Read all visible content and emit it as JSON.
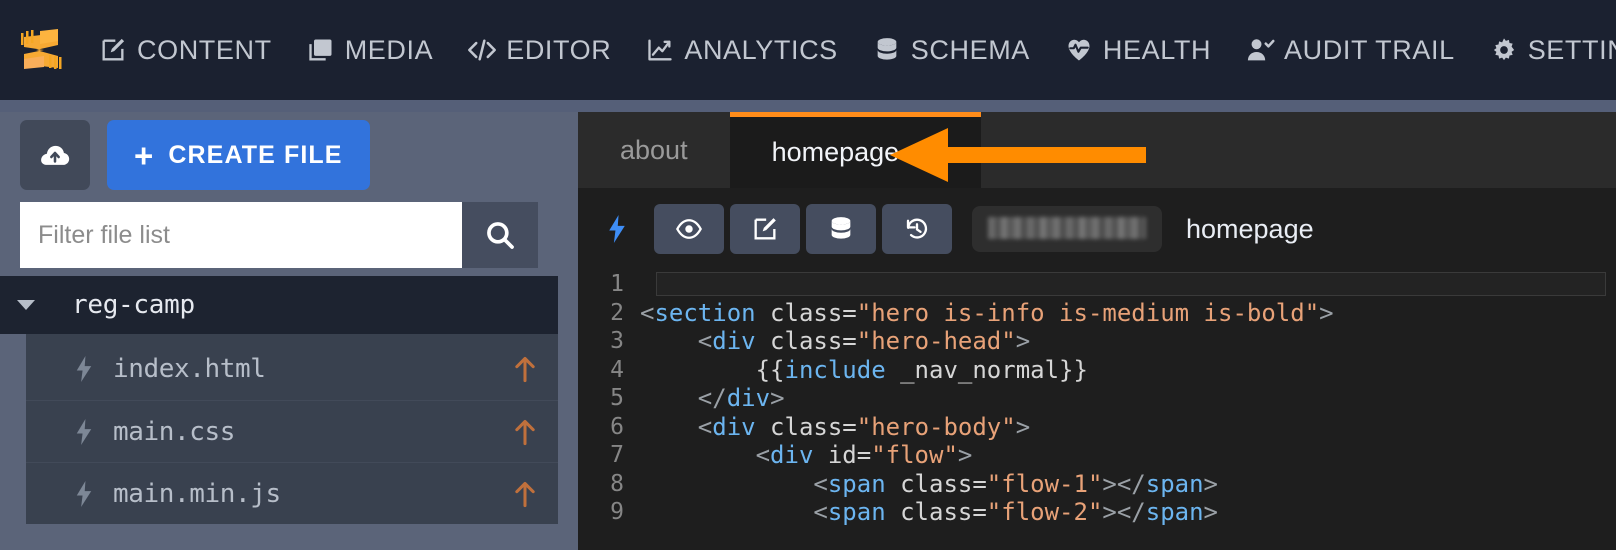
{
  "navbar": {
    "logo_name": "zesty-logo",
    "items": [
      {
        "label": "CONTENT",
        "icon": "content-edit-icon"
      },
      {
        "label": "MEDIA",
        "icon": "media-image-icon"
      },
      {
        "label": "EDITOR",
        "icon": "code-brackets-icon"
      },
      {
        "label": "ANALYTICS",
        "icon": "chart-line-icon"
      },
      {
        "label": "SCHEMA",
        "icon": "database-icon"
      },
      {
        "label": "HEALTH",
        "icon": "heart-pulse-icon"
      },
      {
        "label": "AUDIT TRAIL",
        "icon": "user-check-icon"
      },
      {
        "label": "SETTINGS",
        "icon": "gear-icon"
      }
    ]
  },
  "sidebar": {
    "upload_button": {
      "name": "upload-button",
      "icon": "cloud-upload-icon"
    },
    "create_button": {
      "label": "CREATE FILE",
      "plus": "+"
    },
    "filter": {
      "value": "",
      "placeholder": "Filter file list"
    },
    "search_button": {
      "icon": "search-icon"
    },
    "tree": {
      "folder": {
        "name": "reg-camp",
        "expanded": true,
        "caret": "caret-down-icon"
      },
      "files": [
        {
          "name": "index.html",
          "icon": "lightning-bolt-icon",
          "action": "publish-up-arrow-icon"
        },
        {
          "name": "main.css",
          "icon": "lightning-bolt-icon",
          "action": "publish-up-arrow-icon"
        },
        {
          "name": "main.min.js",
          "icon": "lightning-bolt-icon",
          "action": "publish-up-arrow-icon"
        }
      ]
    }
  },
  "editor": {
    "tabs": [
      {
        "label": "about",
        "active": false,
        "dirty": false
      },
      {
        "label": "homepage",
        "active": true,
        "dirty": true
      }
    ],
    "toolbar": {
      "bolt_icon": "lightning-bolt-icon",
      "buttons": [
        {
          "name": "preview-button",
          "icon": "eye-icon"
        },
        {
          "name": "edit-button",
          "icon": "pencil-square-icon"
        },
        {
          "name": "data-button",
          "icon": "database-icon"
        },
        {
          "name": "history-button",
          "icon": "history-revert-icon"
        }
      ],
      "redacted_field": "",
      "title": "homepage"
    },
    "code": {
      "active_line": 1,
      "lines": [
        {
          "n": "1",
          "tokens": []
        },
        {
          "n": "2",
          "tokens": [
            {
              "t": "<",
              "c": "t-punc"
            },
            {
              "t": "section",
              "c": "t-tag"
            },
            {
              "t": " class=",
              "c": "t-attr"
            },
            {
              "t": "\"hero is-info is-medium is-bold\"",
              "c": "t-str"
            },
            {
              "t": ">",
              "c": "t-punc"
            }
          ]
        },
        {
          "n": "3",
          "tokens": [
            {
              "t": "    <",
              "c": "t-punc"
            },
            {
              "t": "div",
              "c": "t-tag"
            },
            {
              "t": " class=",
              "c": "t-attr"
            },
            {
              "t": "\"hero-head\"",
              "c": "t-str"
            },
            {
              "t": ">",
              "c": "t-punc"
            }
          ]
        },
        {
          "n": "4",
          "tokens": [
            {
              "t": "        {{",
              "c": "t-brace"
            },
            {
              "t": "include",
              "c": "t-tpl"
            },
            {
              "t": " _nav_normal",
              "c": "t-attr"
            },
            {
              "t": "}}",
              "c": "t-brace"
            }
          ]
        },
        {
          "n": "5",
          "tokens": [
            {
              "t": "    </",
              "c": "t-punc"
            },
            {
              "t": "div",
              "c": "t-tag"
            },
            {
              "t": ">",
              "c": "t-punc"
            }
          ]
        },
        {
          "n": "6",
          "tokens": [
            {
              "t": "    <",
              "c": "t-punc"
            },
            {
              "t": "div",
              "c": "t-tag"
            },
            {
              "t": " class=",
              "c": "t-attr"
            },
            {
              "t": "\"hero-body\"",
              "c": "t-str"
            },
            {
              "t": ">",
              "c": "t-punc"
            }
          ]
        },
        {
          "n": "7",
          "tokens": [
            {
              "t": "        <",
              "c": "t-punc"
            },
            {
              "t": "div",
              "c": "t-tag"
            },
            {
              "t": " id=",
              "c": "t-attr"
            },
            {
              "t": "\"flow\"",
              "c": "t-str"
            },
            {
              "t": ">",
              "c": "t-punc"
            }
          ]
        },
        {
          "n": "8",
          "tokens": [
            {
              "t": "            <",
              "c": "t-punc"
            },
            {
              "t": "span",
              "c": "t-tag"
            },
            {
              "t": " class=",
              "c": "t-attr"
            },
            {
              "t": "\"flow-1\"",
              "c": "t-str"
            },
            {
              "t": "></",
              "c": "t-punc"
            },
            {
              "t": "span",
              "c": "t-tag"
            },
            {
              "t": ">",
              "c": "t-punc"
            }
          ]
        },
        {
          "n": "9",
          "tokens": [
            {
              "t": "            <",
              "c": "t-punc"
            },
            {
              "t": "span",
              "c": "t-tag"
            },
            {
              "t": " class=",
              "c": "t-attr"
            },
            {
              "t": "\"flow-2\"",
              "c": "t-str"
            },
            {
              "t": "></",
              "c": "t-punc"
            },
            {
              "t": "span",
              "c": "t-tag"
            },
            {
              "t": ">",
              "c": "t-punc"
            }
          ]
        }
      ]
    }
  },
  "annotation": {
    "arrow": {
      "name": "annotation-arrow-left",
      "points_at": "homepage",
      "color": "#ff8c00"
    }
  },
  "colors": {
    "navbar_bg": "#1b2130",
    "sidebar_bg": "#5b6479",
    "accent_blue": "#3273dc",
    "accent_orange": "#ff8c1a",
    "editor_bg": "#1e1e1e",
    "tabbar_bg": "#2b2b2b"
  }
}
